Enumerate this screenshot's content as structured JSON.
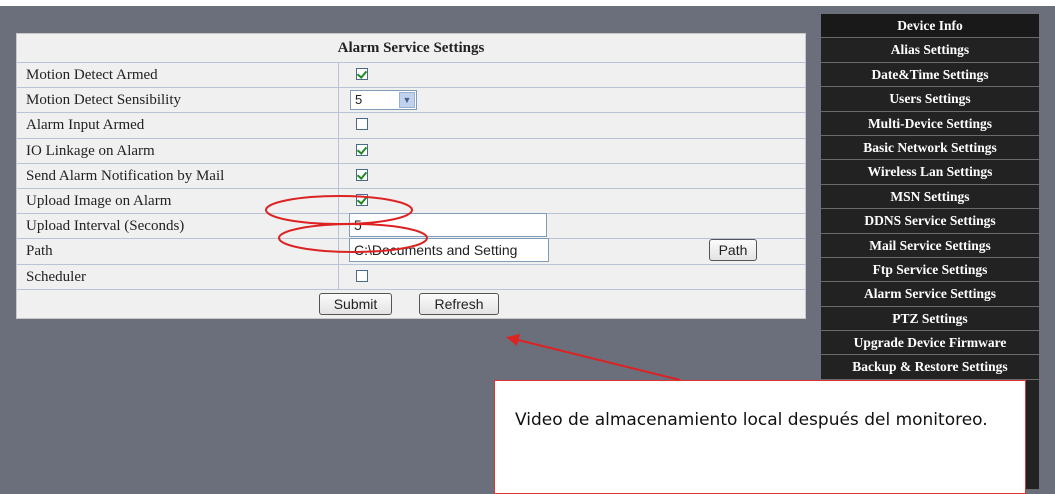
{
  "panel": {
    "title": "Alarm Service Settings",
    "rows": [
      {
        "label": "Motion Detect Armed",
        "checked": true
      },
      {
        "label": "Motion Detect Sensibility",
        "value": "5"
      },
      {
        "label": "Alarm Input Armed",
        "checked": false
      },
      {
        "label": "IO Linkage on Alarm",
        "checked": true
      },
      {
        "label": "Send Alarm Notification by Mail",
        "checked": true
      },
      {
        "label": "Upload Image on Alarm",
        "checked": true
      },
      {
        "label": "Upload Interval (Seconds)",
        "value": "5"
      },
      {
        "label": "Path",
        "value": "C:\\Documents and Setting",
        "button": "Path"
      },
      {
        "label": "Scheduler",
        "checked": false
      }
    ],
    "submit_label": "Submit",
    "refresh_label": "Refresh"
  },
  "menu": {
    "items": [
      "Device Info",
      "Alias Settings",
      "Date&Time Settings",
      "Users Settings",
      "Multi-Device Settings",
      "Basic Network Settings",
      "Wireless Lan Settings",
      "MSN Settings",
      "DDNS Service Settings",
      "Mail Service Settings",
      "Ftp Service Settings",
      "Alarm Service Settings",
      "PTZ Settings",
      "Upgrade Device Firmware",
      "Backup & Restore Settings"
    ]
  },
  "annotation": {
    "text": "Video de almacenamiento local después del monitoreo."
  },
  "colors": {
    "background": "#6b6f7c",
    "menu": "#222222",
    "annotation": "#dd2222"
  }
}
